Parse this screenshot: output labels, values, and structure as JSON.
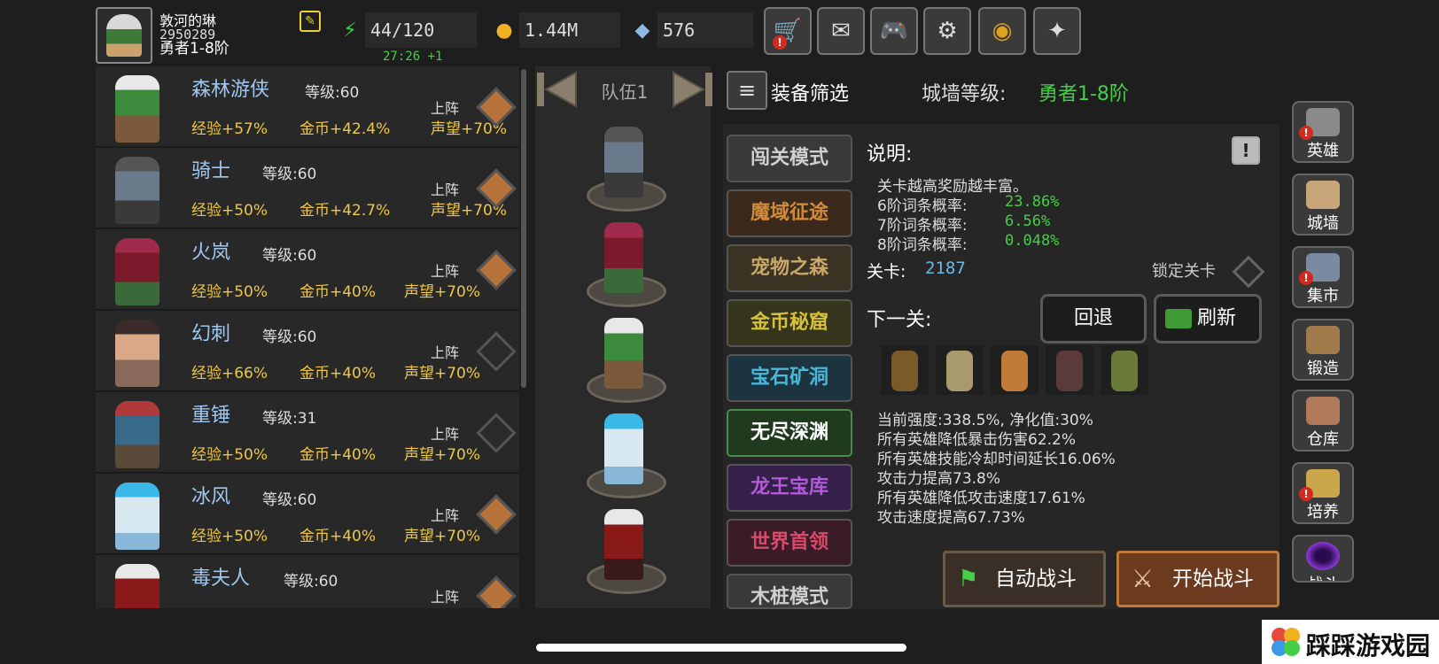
{
  "player": {
    "name": "敦河的琳",
    "id": "2950289",
    "rank": "勇者1-8阶"
  },
  "resources": {
    "energy": "44/120",
    "gold": "1.44M",
    "gems": "576",
    "energy_timer": "27:26 +1"
  },
  "top_buttons": [
    {
      "icon": "shop-cart-icon",
      "alert": true
    },
    {
      "icon": "mail-icon",
      "alert": false
    },
    {
      "icon": "gamepad-icon",
      "alert": false
    },
    {
      "icon": "gear-icon",
      "alert": false
    },
    {
      "icon": "color-wheel-icon",
      "alert": false
    },
    {
      "icon": "firework-icon",
      "alert": false
    }
  ],
  "heroes": [
    {
      "name": "森林游侠",
      "level_label": "等级:60",
      "exp": "经验+57%",
      "gold": "金币+42.4%",
      "fame": "声望+70%",
      "deploy": "上阵",
      "deployed": true
    },
    {
      "name": "骑士",
      "level_label": "等级:60",
      "exp": "经验+50%",
      "gold": "金币+42.7%",
      "fame": "声望+70%",
      "deploy": "上阵",
      "deployed": true
    },
    {
      "name": "火岚",
      "level_label": "等级:60",
      "exp": "经验+50%",
      "gold": "金币+40%",
      "fame": "声望+70%",
      "deploy": "上阵",
      "deployed": true
    },
    {
      "name": "幻刺",
      "level_label": "等级:60",
      "exp": "经验+66%",
      "gold": "金币+40%",
      "fame": "声望+70%",
      "deploy": "上阵",
      "deployed": false
    },
    {
      "name": "重锤",
      "level_label": "等级:31",
      "exp": "经验+50%",
      "gold": "金币+40%",
      "fame": "声望+70%",
      "deploy": "上阵",
      "deployed": false
    },
    {
      "name": "冰风",
      "level_label": "等级:60",
      "exp": "经验+50%",
      "gold": "金币+40%",
      "fame": "声望+70%",
      "deploy": "上阵",
      "deployed": true
    },
    {
      "name": "毒夫人",
      "level_label": "等级:60",
      "exp": "",
      "gold": "",
      "fame": "",
      "deploy": "上阵",
      "deployed": true
    }
  ],
  "team": {
    "label": "队伍1"
  },
  "filter": {
    "label": "装备筛选",
    "wall_label": "城墙等级:",
    "wall_value": "勇者1-8阶"
  },
  "modes": [
    {
      "label": "闯关模式",
      "color": "#cfcfcf",
      "bg": "#3a3a3a"
    },
    {
      "label": "魔域征途",
      "color": "#d08a3a",
      "bg": "#3b2a1c"
    },
    {
      "label": "宠物之森",
      "color": "#c9a86a",
      "bg": "#3a3222"
    },
    {
      "label": "金币秘窟",
      "color": "#d4c13a",
      "bg": "#35341c"
    },
    {
      "label": "宝石矿洞",
      "color": "#4ab6d8",
      "bg": "#1c3440"
    },
    {
      "label": "无尽深渊",
      "color": "#ffffff",
      "bg": "#1f3a1f"
    },
    {
      "label": "龙王宝库",
      "color": "#b25ad8",
      "bg": "#35204a"
    },
    {
      "label": "世界首领",
      "color": "#d84a6a",
      "bg": "#3a1c28"
    },
    {
      "label": "木桩模式",
      "color": "#cfcfcf",
      "bg": "#3a3a3a"
    }
  ],
  "description": {
    "title": "说明:",
    "text": "关卡越高奖励越丰富。",
    "rates": [
      {
        "label": "6阶词条概率:",
        "value": "23.86%"
      },
      {
        "label": "7阶词条概率:",
        "value": "6.56%"
      },
      {
        "label": "8阶词条概率:",
        "value": "0.048%"
      }
    ]
  },
  "stage": {
    "label": "关卡:",
    "value": "2187",
    "lock_label": "锁定关卡"
  },
  "next": {
    "label": "下一关:",
    "retreat": "回退",
    "refresh": "刷新"
  },
  "modifiers": [
    "当前强度:338.5%, 净化值:30%",
    "所有英雄降低暴击伤害62.2%",
    "所有英雄技能冷却时间延长16.06%",
    "攻击力提高73.8%",
    "所有英雄降低攻击速度17.61%",
    "攻击速度提高67.73%"
  ],
  "actions": {
    "auto": "自动战斗",
    "start": "开始战斗"
  },
  "side_nav": [
    {
      "label": "英雄",
      "icon": "helmet-icon",
      "alert": true,
      "color": "#8a8a8a"
    },
    {
      "label": "城墙",
      "icon": "castle-wall-icon",
      "alert": false,
      "color": "#c9a67a"
    },
    {
      "label": "集市",
      "icon": "market-icon",
      "alert": true,
      "color": "#7a8aa0"
    },
    {
      "label": "锻造",
      "icon": "anvil-hammer-icon",
      "alert": false,
      "color": "#a07a4a"
    },
    {
      "label": "仓库",
      "icon": "chest-icon",
      "alert": false,
      "color": "#b07a5a"
    },
    {
      "label": "培养",
      "icon": "goblet-icon",
      "alert": true,
      "color": "#c9a64a"
    },
    {
      "label": "战斗",
      "icon": "portal-icon",
      "alert": false,
      "color": "#8a3ad8"
    }
  ],
  "watermark": {
    "text": "踩踩游戏园"
  }
}
